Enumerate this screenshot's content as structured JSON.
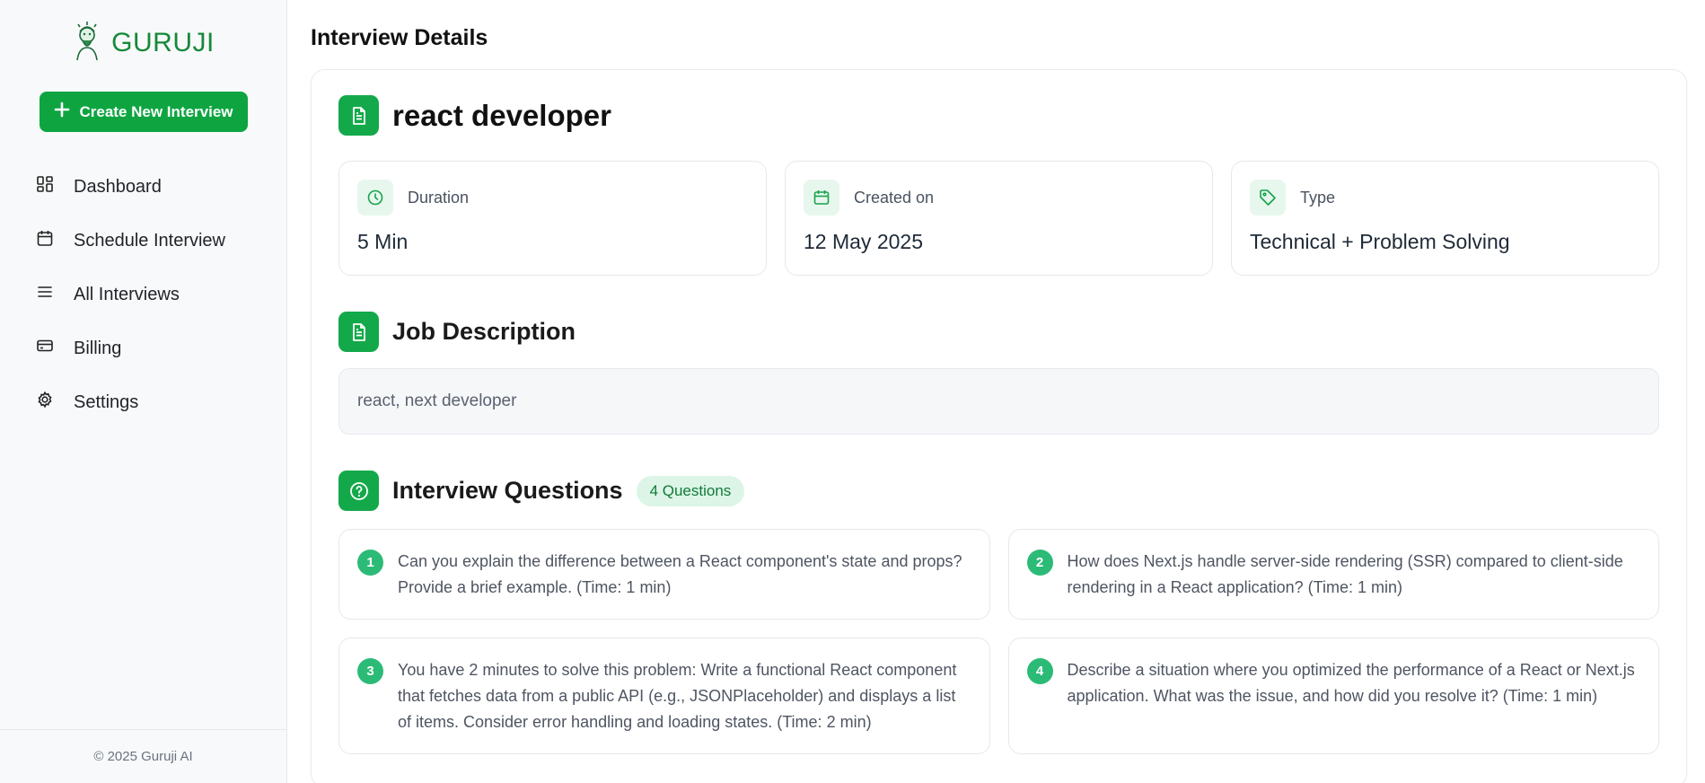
{
  "brand": {
    "name": "GURUJI"
  },
  "sidebar": {
    "create_button": "Create New Interview",
    "items": [
      {
        "label": "Dashboard",
        "icon": "dashboard-icon"
      },
      {
        "label": "Schedule Interview",
        "icon": "calendar-icon"
      },
      {
        "label": "All Interviews",
        "icon": "list-icon"
      },
      {
        "label": "Billing",
        "icon": "credit-card-icon"
      },
      {
        "label": "Settings",
        "icon": "gear-icon"
      }
    ],
    "footer": "© 2025 Guruji AI"
  },
  "page": {
    "title": "Interview Details"
  },
  "interview": {
    "role": "react developer",
    "info": [
      {
        "label": "Duration",
        "value": "5 Min",
        "icon": "clock-icon"
      },
      {
        "label": "Created on",
        "value": "12 May 2025",
        "icon": "calendar-icon"
      },
      {
        "label": "Type",
        "value": "Technical + Problem Solving",
        "icon": "tag-icon"
      }
    ],
    "job_description_title": "Job Description",
    "job_description": "react, next developer",
    "questions_title": "Interview Questions",
    "questions_badge": "4 Questions",
    "questions": [
      {
        "num": "1",
        "text": "Can you explain the difference between a React component's state and props? Provide a brief example. (Time: 1 min)"
      },
      {
        "num": "2",
        "text": "How does Next.js handle server-side rendering (SSR) compared to client-side rendering in a React application? (Time: 1 min)"
      },
      {
        "num": "3",
        "text": "You have 2 minutes to solve this problem: Write a functional React component that fetches data from a public API (e.g., JSONPlaceholder) and displays a list of items. Consider error handling and loading states. (Time: 2 min)"
      },
      {
        "num": "4",
        "text": "Describe a situation where you optimized the performance of a React or Next.js application. What was the issue, and how did you resolve it? (Time: 1 min)"
      }
    ]
  },
  "colors": {
    "accent": "#0ea541",
    "brand": "#16893a"
  }
}
